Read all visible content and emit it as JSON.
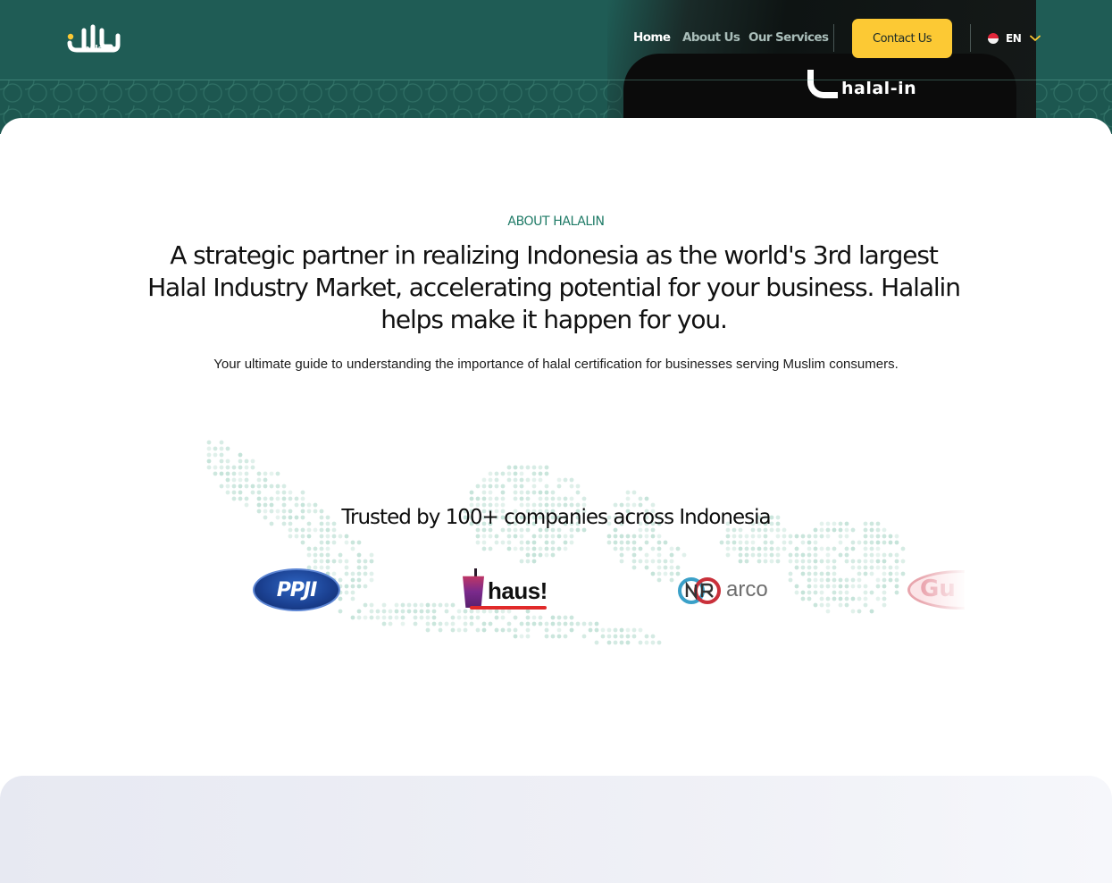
{
  "brand": {
    "logo_wordmark": "halal-in",
    "logo_icon": "halal-arabic-logo-icon"
  },
  "nav": {
    "items": [
      {
        "label": "Home",
        "active": true
      },
      {
        "label": "About Us",
        "active": false
      },
      {
        "label": "Our Services",
        "active": false
      }
    ],
    "contact_label": "Contact Us",
    "language": {
      "code": "EN",
      "flag": "indonesia-flag-icon",
      "chevron": "chevron-down-icon"
    }
  },
  "hero": {
    "shirt_logo_text": "halal-in"
  },
  "about": {
    "eyebrow": "ABOUT HALALIN",
    "headline": "A strategic partner in realizing Indonesia as the world's 3rd largest Halal Industry Market, accelerating potential for your business. Halalin helps make it happen for you.",
    "subtext": "Your ultimate guide to understanding the importance of halal certification for businesses serving Muslim consumers."
  },
  "trusted": {
    "title": "Trusted by 100+ companies across Indonesia",
    "logos": [
      {
        "name": "PPJI",
        "text": "PPJI"
      },
      {
        "name": "haus",
        "text": "haus!"
      },
      {
        "name": "arco",
        "text": "arco"
      },
      {
        "name": "Gu",
        "text": "Gu"
      }
    ]
  },
  "colors": {
    "header_bg": "#1f5c55",
    "accent_yellow": "#fcc934",
    "eyebrow_green": "#1e7a66",
    "map_dot": "#b6dccf"
  }
}
